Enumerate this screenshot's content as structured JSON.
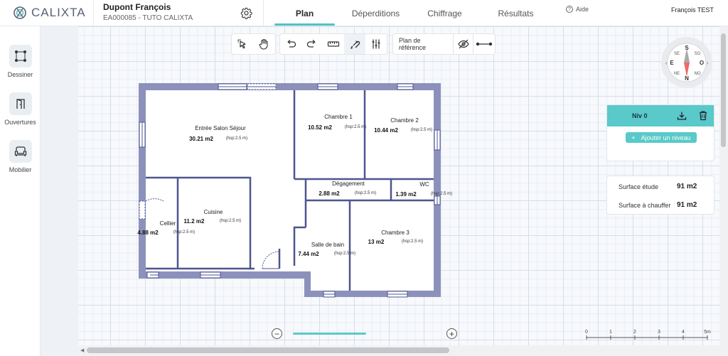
{
  "header": {
    "logo_text": "CALIXTA",
    "client_name": "Dupont François",
    "client_ref": "EA000085 - TUTO CALIXTA",
    "tabs": [
      {
        "label": "Plan",
        "active": true
      },
      {
        "label": "Déperditions",
        "active": false
      },
      {
        "label": "Chiffrage",
        "active": false
      },
      {
        "label": "Résultats",
        "active": false
      }
    ],
    "help_label": "Aide",
    "user_name": "François TEST"
  },
  "left_tools": [
    {
      "label": "Dessiner",
      "icon": "draw-nodes-icon"
    },
    {
      "label": "Ouvertures",
      "icon": "door-icon"
    },
    {
      "label": "Mobilier",
      "icon": "sofa-icon"
    }
  ],
  "drawing_toolbar": {
    "reference_plan_label": "Plan de référence",
    "icons": [
      "select-cursor-icon",
      "hand-pan-icon",
      "undo-icon",
      "redo-icon",
      "ruler-icon",
      "magnet-snap-icon",
      "sliders-icon",
      "visibility-off-icon",
      "line-segment-icon"
    ]
  },
  "compass": {
    "N": "N",
    "S": "S",
    "E": "E",
    "O": "O",
    "NE": "NE",
    "NO": "NO",
    "SE": "SE",
    "SO": "SO"
  },
  "levels_panel": {
    "level_name": "Niv 0",
    "add_level_label": "Ajouter un niveau"
  },
  "surfaces": [
    {
      "label": "Surface étude",
      "value": "91 m2"
    },
    {
      "label": "Surface à chauffer",
      "value": "91 m2"
    }
  ],
  "rooms": [
    {
      "name": "Entrée Salon Séjour",
      "area": "30.21 m2",
      "hsp": "(hsp:2.5 m)"
    },
    {
      "name": "Chambre 1",
      "area": "10.52 m2",
      "hsp": "(hsp:2.5 m)"
    },
    {
      "name": "Chambre 2",
      "area": "10.44 m2",
      "hsp": "(hsp:2.5 m)"
    },
    {
      "name": "Dégagement",
      "area": "2.88 m2",
      "hsp": "(hsp:2.5 m)"
    },
    {
      "name": "WC",
      "area": "1.39 m2",
      "hsp": "(hsp:2.5 m)"
    },
    {
      "name": "Cellier",
      "area": "4.88 m2",
      "hsp": "(hsp:2.5 m)"
    },
    {
      "name": "Cuisine",
      "area": "11.2 m2",
      "hsp": "(hsp:2.5 m)"
    },
    {
      "name": "Salle de bain",
      "area": "7.44 m2",
      "hsp": "(hsp:2.5 m)"
    },
    {
      "name": "Chambre 3",
      "area": "13 m2",
      "hsp": "(hsp:2.5 m)"
    }
  ],
  "scale": [
    "0",
    "1",
    "2",
    "3",
    "4",
    "5m"
  ],
  "zoom": {
    "minus": "−",
    "plus": "+"
  }
}
